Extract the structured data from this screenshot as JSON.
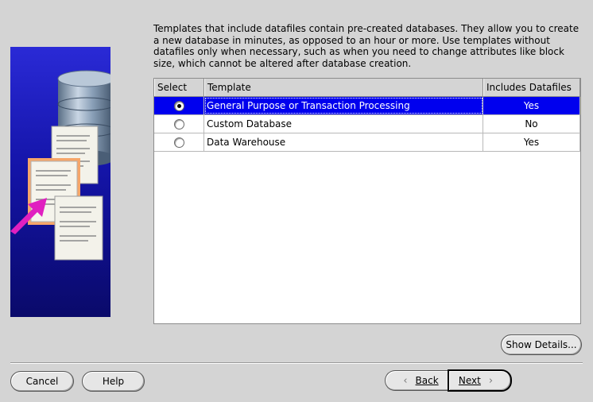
{
  "description": "Templates that include datafiles contain pre-created databases. They allow you to create a new database in minutes, as opposed to an hour or more. Use templates without datafiles only when necessary, such as when you need to change attributes like block size, which cannot be altered after database creation.",
  "table": {
    "columns": [
      "Select",
      "Template",
      "Includes Datafiles"
    ],
    "rows": [
      {
        "template": "General Purpose or Transaction Processing",
        "datafiles": "Yes",
        "selected": true
      },
      {
        "template": "Custom Database",
        "datafiles": "No",
        "selected": false
      },
      {
        "template": "Data Warehouse",
        "datafiles": "Yes",
        "selected": false
      }
    ]
  },
  "buttons": {
    "show_details": "Show Details...",
    "cancel": "Cancel",
    "help": "Help",
    "back": "Back",
    "next": "Next"
  },
  "colors": {
    "selection": "#0000ee",
    "illustration_bg": "#1a1ab8",
    "arrow": "#e020c0"
  }
}
